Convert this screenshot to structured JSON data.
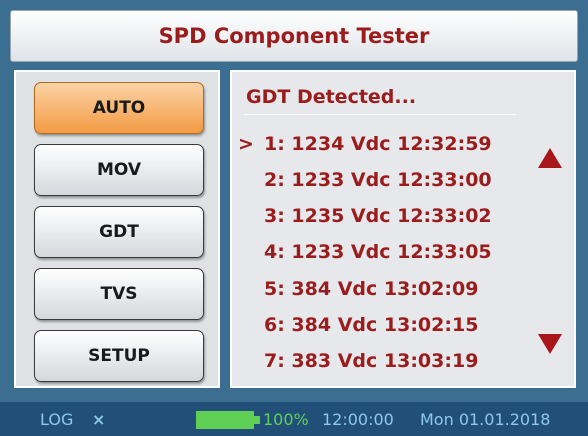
{
  "title": "SPD Component Tester",
  "menu": {
    "buttons": [
      {
        "label": "AUTO",
        "active": true
      },
      {
        "label": "MOV",
        "active": false
      },
      {
        "label": "GDT",
        "active": false
      },
      {
        "label": "TVS",
        "active": false
      },
      {
        "label": "SETUP",
        "active": false
      }
    ]
  },
  "results": {
    "header": "GDT Detected...",
    "cursor": ">",
    "rows": [
      "1: 1234 Vdc 12:32:59",
      "2: 1233 Vdc 12:33:00",
      "3: 1235 Vdc 12:33:02",
      "4: 1233 Vdc 12:33:05",
      "5: 384 Vdc 13:02:09",
      "6: 384 Vdc 13:02:15",
      "7: 383 Vdc 13:03:19"
    ],
    "scroll_up_icon": "triangle-up-icon",
    "scroll_down_icon": "triangle-down-icon"
  },
  "status": {
    "log_label": "LOG",
    "log_close": "×",
    "battery_percent": "100%",
    "battery_level": 1.0,
    "time": "12:00:00",
    "date": "Mon 01.01.2018"
  },
  "colors": {
    "background": "#3c6e91",
    "accent_text": "#9b1c1c",
    "active_button": "#f39b43",
    "status_bar": "#224f78",
    "status_text": "#8ec9e8",
    "battery": "#5fcf55"
  }
}
